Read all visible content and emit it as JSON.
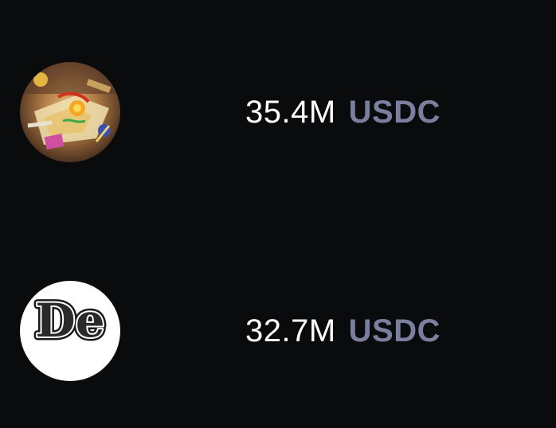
{
  "colors": {
    "background": "#0a0b0d",
    "value_text": "#ffffff",
    "currency_text": "#7a7f9e"
  },
  "rows": [
    {
      "avatar_icon": "painted-desk-avatar",
      "value": "35.4M",
      "currency": "USDC"
    },
    {
      "avatar_icon": "de-logo-avatar",
      "avatar_logo_text": "De",
      "value": "32.7M",
      "currency": "USDC"
    }
  ]
}
